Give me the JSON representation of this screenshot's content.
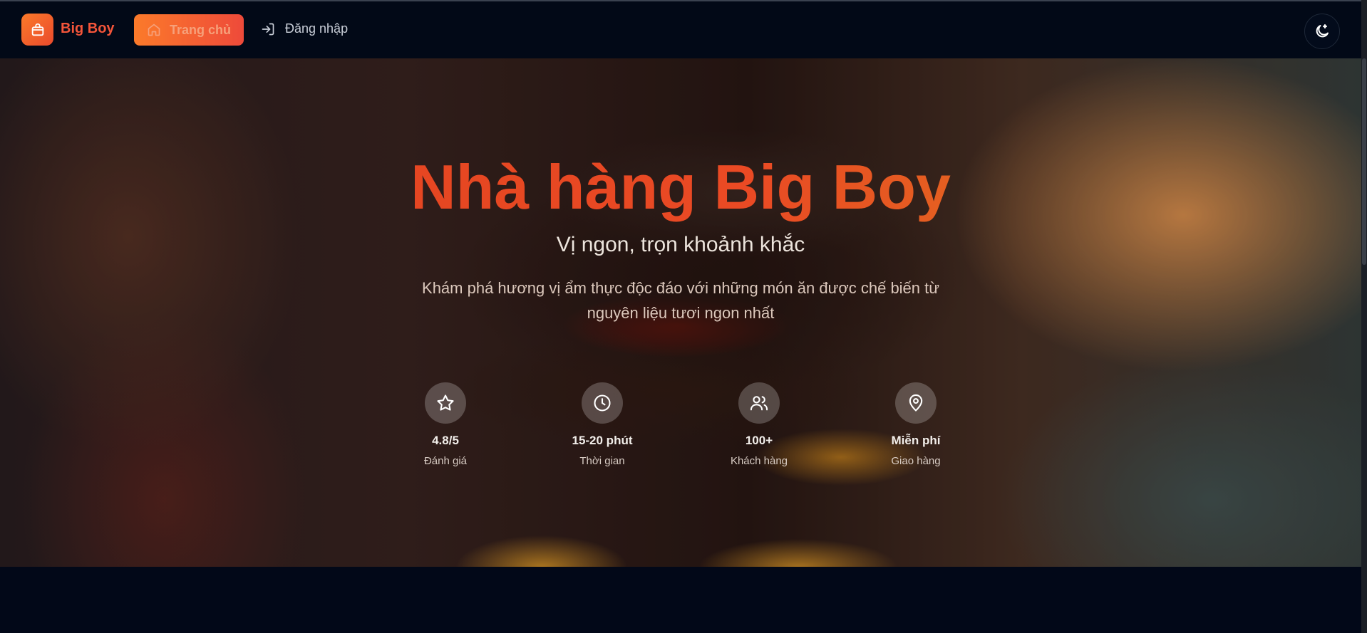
{
  "navbar": {
    "brand": "Big Boy",
    "home_label": "Trang chủ",
    "login_label": "Đăng nhập",
    "logo_icon": "shopping-bag-icon",
    "theme_icon": "moon-icon"
  },
  "hero": {
    "title": "Nhà hàng Big Boy",
    "subtitle": "Vị ngon, trọn khoảnh khắc",
    "description": "Khám phá hương vị ẩm thực độc đáo với những món ăn được chế biến từ nguyên liệu tươi ngon nhất",
    "stats": [
      {
        "icon": "star-icon",
        "value": "4.8/5",
        "label": "Đánh giá"
      },
      {
        "icon": "clock-icon",
        "value": "15-20 phút",
        "label": "Thời gian"
      },
      {
        "icon": "users-icon",
        "value": "100+",
        "label": "Khách hàng"
      },
      {
        "icon": "map-pin-icon",
        "value": "Miễn phí",
        "label": "Giao hàng"
      }
    ]
  },
  "colors": {
    "accent": "#f4553a",
    "accent_gradient_start": "#fb7a2a",
    "background": "#020818"
  }
}
